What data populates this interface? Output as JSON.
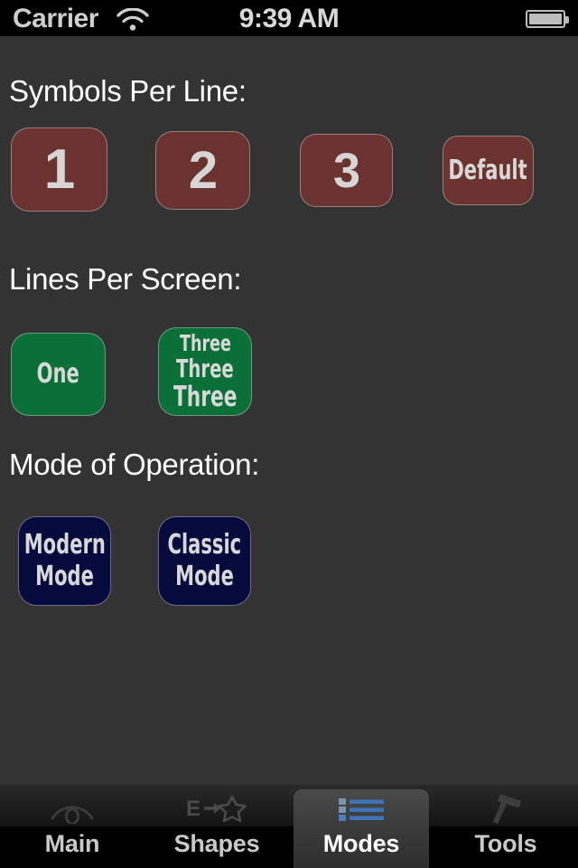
{
  "status_bar": {
    "carrier": "Carrier",
    "wifi_icon": "wifi-icon",
    "time": "9:39 AM",
    "battery_icon": "battery-icon"
  },
  "colors": {
    "background": "#333333",
    "red_button": "#6b3330",
    "green_button": "#0b7038",
    "navy_button": "#070a3c",
    "button_border": "#bebebe",
    "button_text": "#d8d8d8",
    "heading_text": "#ffffff",
    "tab_selected_icon": "#3d74b8",
    "tab_bar_background": "#000000"
  },
  "sections": [
    {
      "title": "Symbols Per Line:",
      "buttons": [
        {
          "label": "1",
          "style": "red",
          "lines": [
            "1"
          ]
        },
        {
          "label": "2",
          "style": "red",
          "lines": [
            "2"
          ]
        },
        {
          "label": "3",
          "style": "red",
          "lines": [
            "3"
          ]
        },
        {
          "label": "Default",
          "style": "red",
          "lines": [
            "Default"
          ]
        }
      ]
    },
    {
      "title": "Lines Per Screen:",
      "buttons": [
        {
          "label": "One",
          "style": "green",
          "lines": [
            "One"
          ]
        },
        {
          "label": "Three Three Three",
          "style": "green",
          "lines": [
            "Three",
            "Three",
            "Three"
          ]
        }
      ]
    },
    {
      "title": "Mode of Operation:",
      "buttons": [
        {
          "label": "Modern Mode",
          "style": "navy",
          "lines": [
            "Modern",
            "Mode"
          ]
        },
        {
          "label": "Classic Mode",
          "style": "navy",
          "lines": [
            "Classic",
            "Mode"
          ]
        }
      ]
    }
  ],
  "tab_bar": {
    "selected_index": 2,
    "tabs": [
      {
        "label": "Main",
        "icon": "eye-icon"
      },
      {
        "label": "Shapes",
        "icon": "letter-e-arrow-star-icon"
      },
      {
        "label": "Modes",
        "icon": "bulleted-list-icon"
      },
      {
        "label": "Tools",
        "icon": "hammer-icon"
      }
    ]
  }
}
